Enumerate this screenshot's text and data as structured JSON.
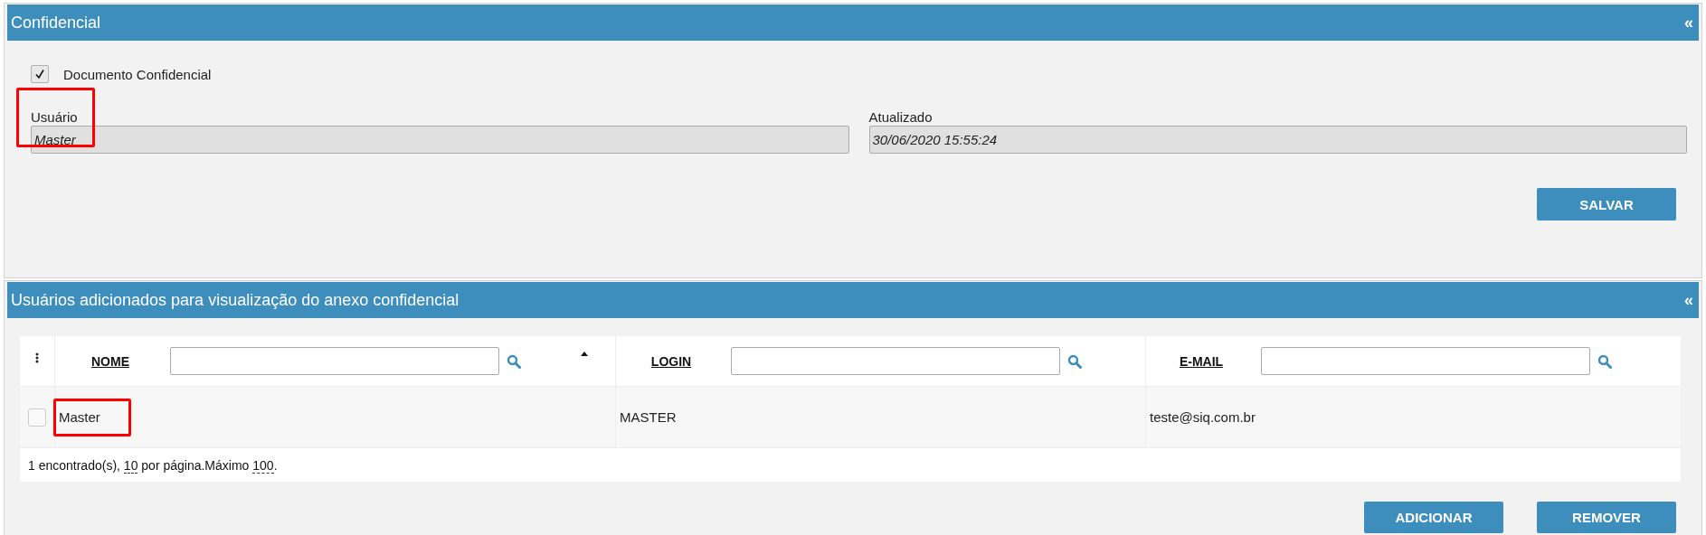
{
  "panels": [
    {
      "title": "Confidencial",
      "collapse_icon": "«",
      "checkbox": {
        "label": "Documento Confidencial",
        "checked": true
      },
      "fields": [
        {
          "label": "Usuário",
          "value": "Master",
          "highlighted": true
        },
        {
          "label": "Atualizado",
          "value": "30/06/2020 15:55:24",
          "highlighted": false
        }
      ],
      "buttons": [
        "SALVAR"
      ]
    },
    {
      "title": "Usuários adicionados para visualização do anexo confidencial",
      "collapse_icon": "«",
      "table": {
        "columns": [
          {
            "label": "NOME",
            "sorted": true
          },
          {
            "label": "LOGIN",
            "sorted": false
          },
          {
            "label": "E-MAIL",
            "sorted": false
          }
        ],
        "rows": [
          {
            "checked": false,
            "cells": [
              {
                "text": "Master",
                "highlighted": true
              },
              {
                "text": "MASTER",
                "highlighted": false
              },
              {
                "text": "teste@siq.com.br",
                "highlighted": false
              }
            ]
          }
        ],
        "pagination": {
          "prefix": "1 encontrado(s), ",
          "page_size": "10",
          "middle": " por página.Máximo ",
          "maximum": "100",
          "suffix": "."
        }
      },
      "buttons": [
        "ADICIONAR",
        "REMOVER"
      ]
    }
  ]
}
